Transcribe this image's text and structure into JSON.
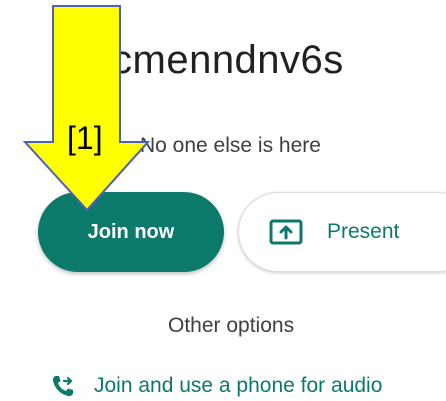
{
  "meeting": {
    "code": "cmenndnv6s",
    "presence": "No one else is here"
  },
  "actions": {
    "join_label": "Join now",
    "present_label": "Present",
    "present_icon": "present-screen-icon"
  },
  "options": {
    "other_label": "Other options",
    "phone_label": "Join and use a phone for audio",
    "phone_icon": "phone-forward-icon"
  },
  "annotation": {
    "label": "[1]",
    "color": "#ffff00",
    "outline": "#4a5fbf"
  },
  "colors": {
    "accent": "#0b7a6b"
  }
}
